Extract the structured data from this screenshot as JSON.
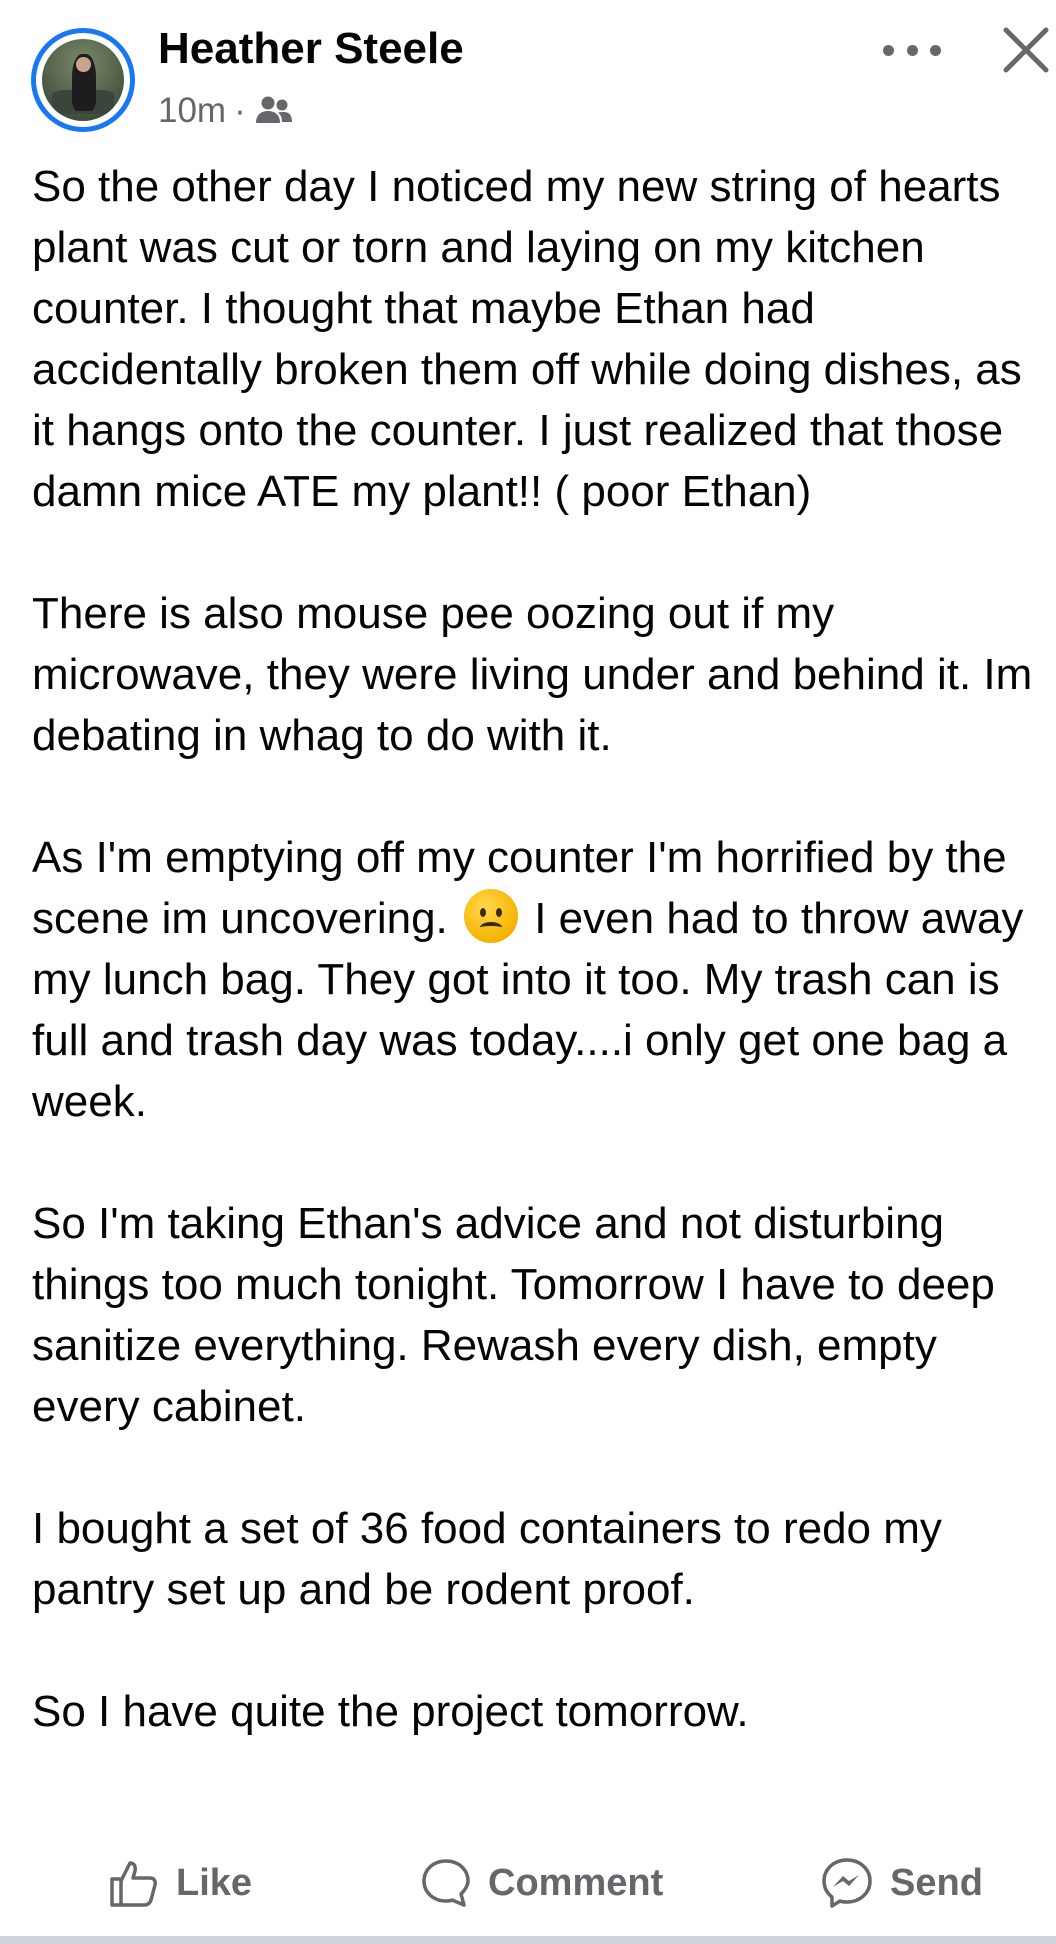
{
  "post": {
    "author": "Heather Steele",
    "time": "10m",
    "separator": "·",
    "audience_icon": "friends-icon",
    "paragraphs": [
      "So the other day I noticed my new string of hearts plant was cut or torn and laying on my kitchen counter. I thought that maybe Ethan had accidentally broken them off while doing dishes, as it hangs onto the counter. I just realized that those damn mice ATE my plant!! ( poor Ethan)",
      "There is also mouse pee oozing out if my microwave, they were living under and behind it. Im debating in whag to do with it.",
      "I even had to throw away my lunch bag. They got into it too. My trash can is full and trash day was today....i only get one bag a week.",
      "So I'm taking Ethan's advice and not disturbing things too much tonight. Tomorrow I have to deep sanitize everything. Rewash every dish, empty every cabinet.",
      "I bought a set of 36 food containers to redo my pantry set up and be rodent proof.",
      "So I have quite the project tomorrow."
    ],
    "para3_lead": "As I'm emptying off my counter I'm horrified by the scene im uncovering.",
    "para3_emoji": "frowning-face-emoji"
  },
  "actions": {
    "like": "Like",
    "comment": "Comment",
    "send": "Send"
  },
  "colors": {
    "accent": "#1877f2",
    "text": "#050505",
    "secondary": "#65676b"
  }
}
